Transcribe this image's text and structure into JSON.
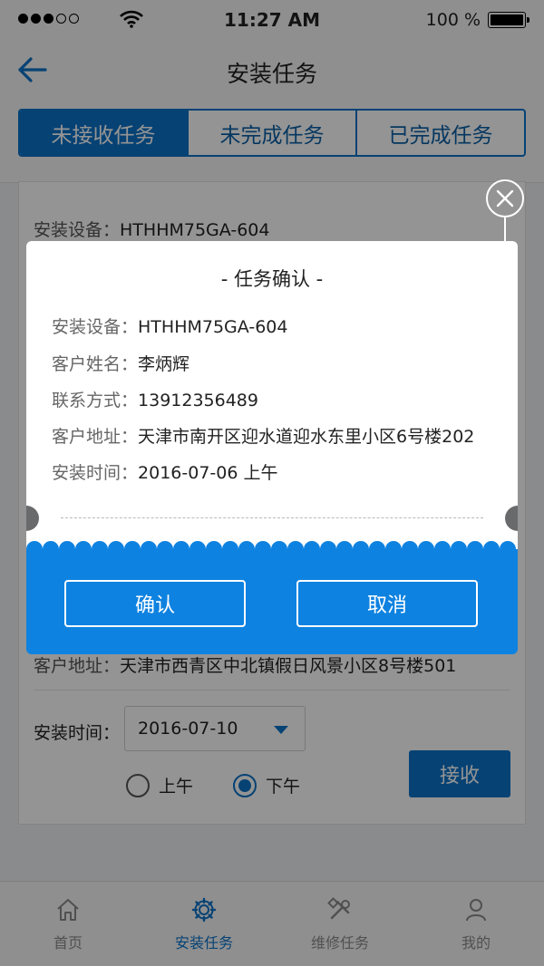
{
  "status_bar": {
    "time": "11:27 AM",
    "battery": "100 %"
  },
  "nav": {
    "title": "安装任务"
  },
  "tabs": [
    {
      "label": "未接收任务",
      "active": true
    },
    {
      "label": "未完成任务",
      "active": false
    },
    {
      "label": "已完成任务",
      "active": false
    }
  ],
  "card": {
    "device_label": "安装设备：",
    "device": "HTHHM75GA-604",
    "address_label": "客户地址：",
    "address": "天津市西青区中北镇假日风景小区8号楼501",
    "time_label": "安装时间：",
    "date": "2016-07-10",
    "am_label": "上午",
    "pm_label": "下午",
    "selected_period": "下午",
    "accept_label": "接收"
  },
  "dialog": {
    "title": "-  任务确认  -",
    "rows": [
      {
        "label": "安装设备：",
        "value": "HTHHM75GA-604"
      },
      {
        "label": "客户姓名：",
        "value": "李炳辉"
      },
      {
        "label": "联系方式：",
        "value": "13912356489"
      },
      {
        "label": "客户地址：",
        "value": "天津市南开区迎水道迎水东里小区6号楼202"
      },
      {
        "label": "安装时间：",
        "value": "2016-07-06  上午"
      }
    ],
    "confirm_label": "确认",
    "cancel_label": "取消"
  },
  "tabbar": [
    {
      "label": "首页",
      "icon": "home-icon",
      "active": false
    },
    {
      "label": "安装任务",
      "icon": "gear-icon",
      "active": true
    },
    {
      "label": "维修任务",
      "icon": "tools-icon",
      "active": false
    },
    {
      "label": "我的",
      "icon": "user-icon",
      "active": false
    }
  ],
  "colors": {
    "primary": "#0b72c8",
    "dialog_bottom": "#0e82e0"
  }
}
